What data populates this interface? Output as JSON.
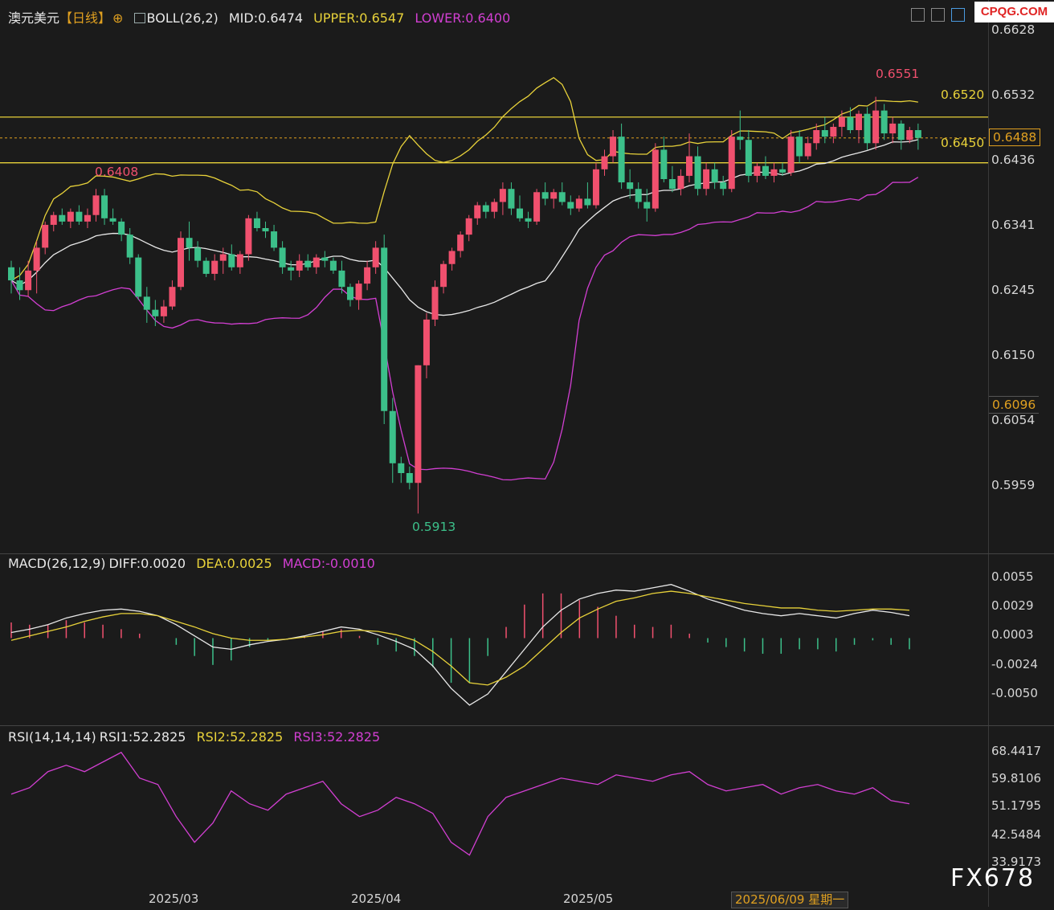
{
  "header": {
    "symbol": "澳元美元",
    "period": "【日线】",
    "boll_name": "BOLL(26,2)",
    "boll_mid": "MID:0.6474",
    "boll_upper": "UPPER:0.6547",
    "boll_lower": "LOWER:0.6400",
    "gear_icon": "settings-icon",
    "chart_icon": "indicator-icon"
  },
  "site_logo": "CPQG.COM",
  "watermark": "FX678",
  "colors": {
    "bg": "#1b1b1b",
    "up": "#f0506e",
    "down": "#3cc08a",
    "mid": "#e8e8e8",
    "upper": "#e8d23a",
    "lower": "#d23fd2",
    "hline": "#e8d23a",
    "accent": "#e0a020"
  },
  "price_axis": {
    "ticks": [
      "0.6628",
      "0.6532",
      "0.6436",
      "0.6341",
      "0.6245",
      "0.6150",
      "0.6054",
      "0.5959"
    ],
    "current_price": "0.6488",
    "cursor_price": "0.6096"
  },
  "annotations": {
    "high_label": "0.6551",
    "low_label": "0.5913",
    "left_high_label": "0.6408",
    "resistance_label": "0.6520",
    "support_label": "0.6450"
  },
  "macd": {
    "name": "MACD(26,12,9)",
    "diff": "DIFF:0.0020",
    "dea": "DEA:0.0025",
    "macd": "MACD:-0.0010",
    "ticks": [
      "0.0055",
      "0.0029",
      "0.0003",
      "-0.0024",
      "-0.0050"
    ]
  },
  "rsi": {
    "name": "RSI(14,14,14)",
    "rsi1": "RSI1:52.2825",
    "rsi2": "RSI2:52.2825",
    "rsi3": "RSI3:52.2825",
    "ticks": [
      "68.4417",
      "59.8106",
      "51.1795",
      "42.5484",
      "33.9173"
    ]
  },
  "x_axis": {
    "labels": [
      "2025/03",
      "2025/04",
      "2025/05"
    ],
    "cursor_date": "2025/06/09 星期一"
  },
  "chart_data": [
    {
      "type": "candlestick",
      "title": "澳元美元 日线",
      "ylim": [
        0.59,
        0.665
      ],
      "note_levels": {
        "resistance": 0.652,
        "support": 0.645,
        "last": 0.6488
      },
      "candles": [
        [
          0.629,
          0.63,
          0.625,
          0.627
        ],
        [
          0.627,
          0.629,
          0.624,
          0.6255
        ],
        [
          0.6255,
          0.63,
          0.6245,
          0.6285
        ],
        [
          0.6285,
          0.633,
          0.625,
          0.632
        ],
        [
          0.632,
          0.636,
          0.631,
          0.6355
        ],
        [
          0.6355,
          0.6375,
          0.6345,
          0.637
        ],
        [
          0.637,
          0.638,
          0.6355,
          0.636
        ],
        [
          0.636,
          0.638,
          0.635,
          0.6375
        ],
        [
          0.6375,
          0.6385,
          0.6355,
          0.636
        ],
        [
          0.636,
          0.638,
          0.635,
          0.637
        ],
        [
          0.637,
          0.641,
          0.636,
          0.64
        ],
        [
          0.64,
          0.641,
          0.6355,
          0.6365
        ],
        [
          0.6365,
          0.638,
          0.6355,
          0.636
        ],
        [
          0.636,
          0.6365,
          0.633,
          0.634
        ],
        [
          0.634,
          0.635,
          0.6295,
          0.6305
        ],
        [
          0.6305,
          0.631,
          0.624,
          0.6245
        ],
        [
          0.6245,
          0.626,
          0.6205,
          0.6225
        ],
        [
          0.6225,
          0.624,
          0.62,
          0.6215
        ],
        [
          0.6215,
          0.624,
          0.6205,
          0.623
        ],
        [
          0.623,
          0.627,
          0.6225,
          0.626
        ],
        [
          0.626,
          0.6345,
          0.6255,
          0.6335
        ],
        [
          0.6335,
          0.636,
          0.63,
          0.632
        ],
        [
          0.632,
          0.633,
          0.629,
          0.63
        ],
        [
          0.63,
          0.6305,
          0.6275,
          0.628
        ],
        [
          0.628,
          0.631,
          0.627,
          0.63
        ],
        [
          0.63,
          0.632,
          0.628,
          0.631
        ],
        [
          0.631,
          0.6325,
          0.6285,
          0.629
        ],
        [
          0.629,
          0.6315,
          0.628,
          0.631
        ],
        [
          0.631,
          0.637,
          0.63,
          0.6365
        ],
        [
          0.6365,
          0.6375,
          0.6345,
          0.635
        ],
        [
          0.635,
          0.636,
          0.6335,
          0.6345
        ],
        [
          0.6345,
          0.6355,
          0.6315,
          0.632
        ],
        [
          0.632,
          0.633,
          0.628,
          0.629
        ],
        [
          0.629,
          0.63,
          0.627,
          0.6285
        ],
        [
          0.6285,
          0.631,
          0.6275,
          0.63
        ],
        [
          0.63,
          0.631,
          0.6285,
          0.629
        ],
        [
          0.629,
          0.631,
          0.628,
          0.6305
        ],
        [
          0.6305,
          0.6315,
          0.629,
          0.63
        ],
        [
          0.63,
          0.6305,
          0.628,
          0.6285
        ],
        [
          0.6285,
          0.63,
          0.625,
          0.626
        ],
        [
          0.626,
          0.6265,
          0.623,
          0.624
        ],
        [
          0.624,
          0.627,
          0.6225,
          0.6265
        ],
        [
          0.6265,
          0.63,
          0.6255,
          0.629
        ],
        [
          0.629,
          0.633,
          0.628,
          0.632
        ],
        [
          0.632,
          0.634,
          0.605,
          0.607
        ],
        [
          0.607,
          0.609,
          0.596,
          0.599
        ],
        [
          0.599,
          0.6,
          0.596,
          0.5975
        ],
        [
          0.5975,
          0.5985,
          0.595,
          0.596
        ],
        [
          0.596,
          0.614,
          0.5913,
          0.614
        ],
        [
          0.614,
          0.622,
          0.612,
          0.621
        ],
        [
          0.621,
          0.627,
          0.62,
          0.626
        ],
        [
          0.626,
          0.63,
          0.625,
          0.6295
        ],
        [
          0.6295,
          0.632,
          0.6285,
          0.6315
        ],
        [
          0.6315,
          0.6345,
          0.6305,
          0.634
        ],
        [
          0.634,
          0.637,
          0.633,
          0.6365
        ],
        [
          0.6365,
          0.639,
          0.6355,
          0.6385
        ],
        [
          0.6385,
          0.639,
          0.6365,
          0.6375
        ],
        [
          0.6375,
          0.6395,
          0.6365,
          0.639
        ],
        [
          0.639,
          0.642,
          0.637,
          0.641
        ],
        [
          0.641,
          0.642,
          0.637,
          0.638
        ],
        [
          0.638,
          0.64,
          0.636,
          0.6365
        ],
        [
          0.6365,
          0.6375,
          0.635,
          0.636
        ],
        [
          0.636,
          0.641,
          0.6355,
          0.6405
        ],
        [
          0.6405,
          0.642,
          0.6385,
          0.6395
        ],
        [
          0.6395,
          0.641,
          0.638,
          0.6405
        ],
        [
          0.6405,
          0.642,
          0.6385,
          0.639
        ],
        [
          0.639,
          0.64,
          0.637,
          0.638
        ],
        [
          0.638,
          0.64,
          0.6375,
          0.6395
        ],
        [
          0.6395,
          0.642,
          0.638,
          0.6385
        ],
        [
          0.6385,
          0.645,
          0.638,
          0.644
        ],
        [
          0.644,
          0.647,
          0.643,
          0.646
        ],
        [
          0.646,
          0.65,
          0.645,
          0.649
        ],
        [
          0.649,
          0.651,
          0.641,
          0.642
        ],
        [
          0.642,
          0.644,
          0.6395,
          0.641
        ],
        [
          0.641,
          0.642,
          0.638,
          0.639
        ],
        [
          0.639,
          0.641,
          0.636,
          0.638
        ],
        [
          0.638,
          0.648,
          0.6375,
          0.647
        ],
        [
          0.647,
          0.649,
          0.642,
          0.6425
        ],
        [
          0.6425,
          0.6445,
          0.6405,
          0.641
        ],
        [
          0.641,
          0.644,
          0.64,
          0.643
        ],
        [
          0.643,
          0.6495,
          0.642,
          0.646
        ],
        [
          0.646,
          0.6475,
          0.64,
          0.641
        ],
        [
          0.641,
          0.645,
          0.64,
          0.644
        ],
        [
          0.644,
          0.645,
          0.641,
          0.642
        ],
        [
          0.642,
          0.643,
          0.64,
          0.641
        ],
        [
          0.641,
          0.65,
          0.6405,
          0.649
        ],
        [
          0.649,
          0.653,
          0.647,
          0.6485
        ],
        [
          0.6485,
          0.65,
          0.642,
          0.643
        ],
        [
          0.643,
          0.645,
          0.642,
          0.6445
        ],
        [
          0.6445,
          0.646,
          0.6425,
          0.643
        ],
        [
          0.643,
          0.645,
          0.642,
          0.644
        ],
        [
          0.644,
          0.645,
          0.643,
          0.6435
        ],
        [
          0.6435,
          0.65,
          0.643,
          0.649
        ],
        [
          0.649,
          0.65,
          0.645,
          0.646
        ],
        [
          0.646,
          0.649,
          0.6455,
          0.648
        ],
        [
          0.648,
          0.651,
          0.647,
          0.65
        ],
        [
          0.65,
          0.652,
          0.648,
          0.649
        ],
        [
          0.649,
          0.651,
          0.648,
          0.6505
        ],
        [
          0.6505,
          0.653,
          0.649,
          0.652
        ],
        [
          0.652,
          0.6535,
          0.6495,
          0.65
        ],
        [
          0.65,
          0.653,
          0.648,
          0.6525
        ],
        [
          0.6525,
          0.6535,
          0.647,
          0.648
        ],
        [
          0.648,
          0.6551,
          0.647,
          0.653
        ],
        [
          0.653,
          0.654,
          0.6485,
          0.6495
        ],
        [
          0.6495,
          0.652,
          0.648,
          0.651
        ],
        [
          0.651,
          0.6515,
          0.647,
          0.6485
        ],
        [
          0.6485,
          0.6505,
          0.648,
          0.65
        ],
        [
          0.65,
          0.651,
          0.647,
          0.6488
        ]
      ]
    },
    {
      "type": "line",
      "title": "MACD(26,12,9)",
      "series": [
        {
          "name": "DIFF",
          "values": [
            0.0005,
            0.0008,
            0.0012,
            0.0018,
            0.0022,
            0.0025,
            0.0026,
            0.0024,
            0.002,
            0.0012,
            0.0002,
            -0.0008,
            -0.001,
            -0.0006,
            -0.0003,
            -0.0001,
            0.0002,
            0.0006,
            0.001,
            0.0008,
            0.0003,
            -0.0003,
            -0.001,
            -0.0025,
            -0.0045,
            -0.006,
            -0.005,
            -0.003,
            -0.001,
            0.001,
            0.0025,
            0.0035,
            0.004,
            0.0043,
            0.0042,
            0.0045,
            0.0048,
            0.0042,
            0.0035,
            0.003,
            0.0025,
            0.0022,
            0.002,
            0.0022,
            0.002,
            0.0018,
            0.0022,
            0.0025,
            0.0023,
            0.002
          ]
        },
        {
          "name": "DEA",
          "values": [
            -0.0002,
            0.0002,
            0.0006,
            0.001,
            0.0015,
            0.0019,
            0.0022,
            0.0022,
            0.002,
            0.0015,
            0.001,
            0.0004,
            0.0,
            -0.0002,
            -0.0002,
            -0.0001,
            0.0001,
            0.0003,
            0.0006,
            0.0007,
            0.0006,
            0.0003,
            -0.0002,
            -0.0012,
            -0.0025,
            -0.004,
            -0.0042,
            -0.0035,
            -0.0025,
            -0.001,
            0.0005,
            0.0018,
            0.0026,
            0.0033,
            0.0036,
            0.004,
            0.0042,
            0.004,
            0.0037,
            0.0034,
            0.0031,
            0.0029,
            0.0027,
            0.0027,
            0.0025,
            0.0024,
            0.0025,
            0.0026,
            0.0026,
            0.0025
          ]
        }
      ]
    },
    {
      "type": "line",
      "title": "RSI(14,14,14)",
      "series": [
        {
          "name": "RSI1",
          "values": [
            55,
            57,
            62,
            64,
            62,
            65,
            68,
            60,
            58,
            48,
            40,
            46,
            56,
            52,
            50,
            55,
            57,
            59,
            52,
            48,
            50,
            54,
            52,
            49,
            40,
            36,
            48,
            54,
            56,
            58,
            60,
            59,
            58,
            61,
            60,
            59,
            61,
            62,
            58,
            56,
            57,
            58,
            55,
            57,
            58,
            56,
            55,
            57,
            53,
            52
          ]
        }
      ]
    }
  ]
}
